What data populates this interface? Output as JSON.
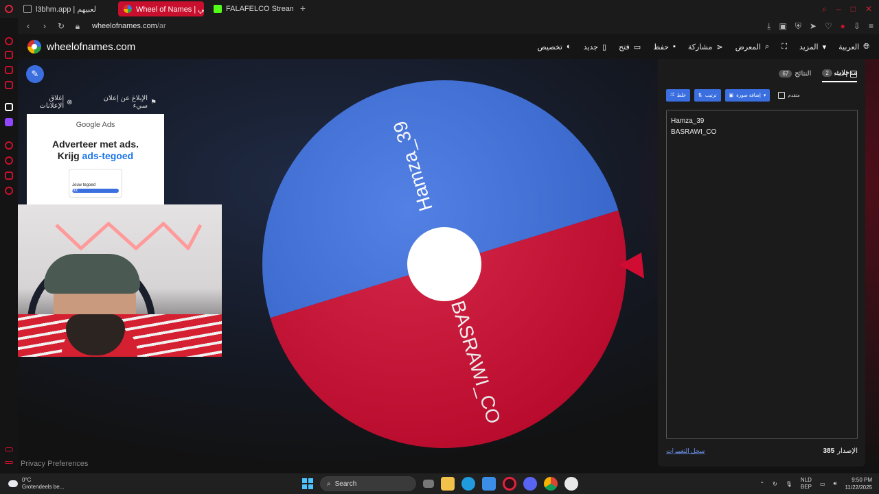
{
  "browser": {
    "tabs": [
      {
        "label": "l3bhm.app | لعبيهم",
        "active": false
      },
      {
        "label": "Wheel of Names | عشوائي",
        "active": true
      },
      {
        "label": "FALAFELCO Stream - Wal",
        "active": false
      }
    ],
    "url_host": "wheelofnames.com",
    "url_path": "/ar"
  },
  "site": {
    "brand": "wheelofnames.com",
    "menu": [
      "تخصيص",
      "جديد",
      "فتح",
      "حفظ",
      "مشاركة",
      "المعرض",
      "المزيد",
      "العربية"
    ]
  },
  "ads": {
    "close_label": "إغلاق الإعلانات",
    "report_label": "الإبلاغ عن إعلان سيء",
    "brand": "Google Ads",
    "headline_1": "Adverteer met ads.",
    "headline_2": "Krijg",
    "headline_highlight": "ads-tegoed",
    "card_text": "Jouw tegoed",
    "card_bar": "€€€"
  },
  "privacy": "Privacy Preferences",
  "wheel": {
    "segments": [
      {
        "label": "Hamza_39",
        "color": "#3b6fe0"
      },
      {
        "label": "BASRAWI_CO",
        "color": "#d10c32"
      }
    ]
  },
  "panel": {
    "tab_entries": "مدخلات",
    "tab_entries_count": "2",
    "tab_results": "النتائج",
    "tab_results_count": "67",
    "hide_label": "إخفاء",
    "btn_shuffle": "خلط",
    "btn_sort": "ترتيب",
    "btn_add_image": "إضافة صورة",
    "advanced_label": "متقدم",
    "entries": [
      "Hamza_39",
      "BASRAWI_CO"
    ],
    "version_label": "الإصدار",
    "version_number": "385",
    "changelog": "سجل التغييرات"
  },
  "taskbar": {
    "temp": "0°C",
    "weather": "Grotendeels be...",
    "search": "Search",
    "lang_1": "NLD",
    "lang_2": "BEP",
    "time": "9:50 PM",
    "date": "11/22/2025"
  }
}
